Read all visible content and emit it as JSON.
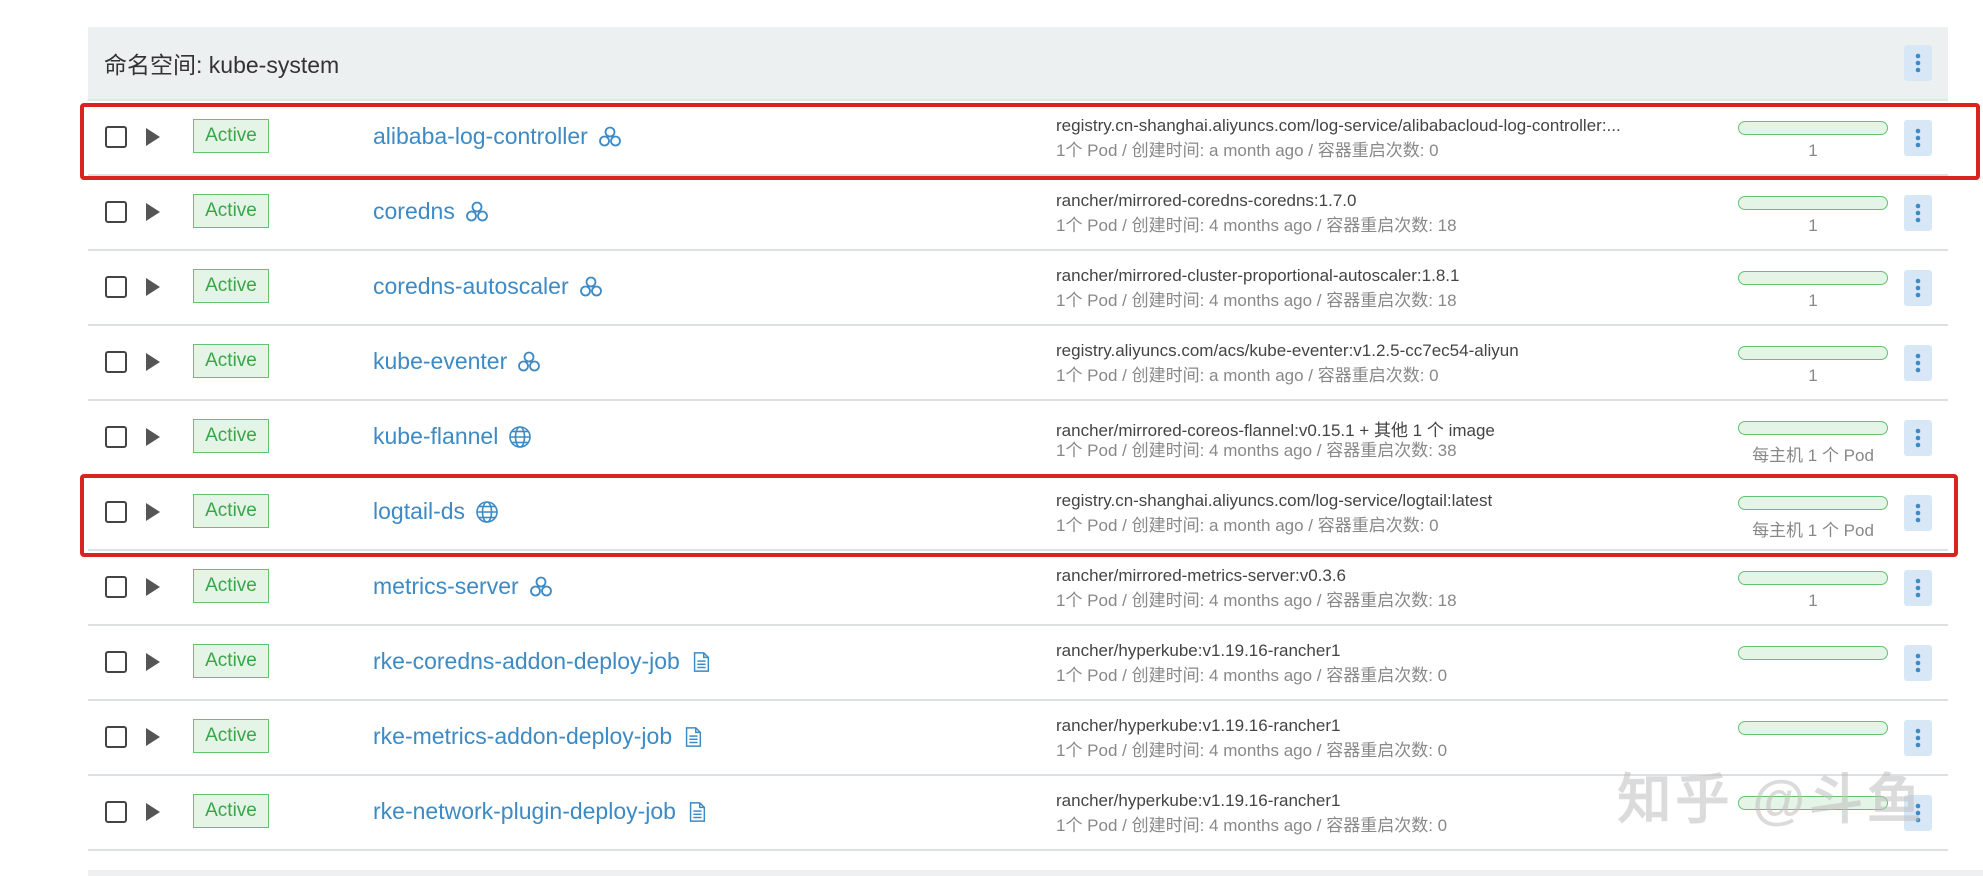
{
  "namespace": {
    "title": "命名空间: kube-system"
  },
  "rows": [
    {
      "state": "Active",
      "name": "alibaba-log-controller",
      "icon": "deployment-icon",
      "image": "registry.cn-shanghai.aliyuncs.com/log-service/alibabacloud-log-controller:...",
      "meta": "1个 Pod / 创建时间: a month ago / 容器重启次数: 0",
      "scale": "1",
      "scale_fill": 1.0
    },
    {
      "state": "Active",
      "name": "coredns",
      "icon": "deployment-icon",
      "image": "rancher/mirrored-coredns-coredns:1.7.0",
      "meta": "1个 Pod / 创建时间: 4 months ago / 容器重启次数: 18",
      "scale": "1",
      "scale_fill": 1.0
    },
    {
      "state": "Active",
      "name": "coredns-autoscaler",
      "icon": "deployment-icon",
      "image": "rancher/mirrored-cluster-proportional-autoscaler:1.8.1",
      "meta": "1个 Pod / 创建时间: 4 months ago / 容器重启次数: 18",
      "scale": "1",
      "scale_fill": 1.0
    },
    {
      "state": "Active",
      "name": "kube-eventer",
      "icon": "deployment-icon",
      "image": "registry.aliyuncs.com/acs/kube-eventer:v1.2.5-cc7ec54-aliyun",
      "meta": "1个 Pod / 创建时间: a month ago / 容器重启次数: 0",
      "scale": "1",
      "scale_fill": 1.0
    },
    {
      "state": "Active",
      "name": "kube-flannel",
      "icon": "globe-icon",
      "image": "rancher/mirrored-coreos-flannel:v0.15.1 + 其他 1 个 image",
      "meta": "1个 Pod / 创建时间: 4 months ago / 容器重启次数: 38",
      "scale": "每主机 1 个 Pod",
      "scale_fill": 1.0
    },
    {
      "state": "Active",
      "name": "logtail-ds",
      "icon": "globe-icon",
      "image": "registry.cn-shanghai.aliyuncs.com/log-service/logtail:latest",
      "meta": "1个 Pod / 创建时间: a month ago / 容器重启次数: 0",
      "scale": "每主机 1 个 Pod",
      "scale_fill": 1.0
    },
    {
      "state": "Active",
      "name": "metrics-server",
      "icon": "deployment-icon",
      "image": "rancher/mirrored-metrics-server:v0.3.6",
      "meta": "1个 Pod / 创建时间: 4 months ago / 容器重启次数: 18",
      "scale": "1",
      "scale_fill": 1.0
    },
    {
      "state": "Active",
      "name": "rke-coredns-addon-deploy-job",
      "icon": "document-icon",
      "image": "rancher/hyperkube:v1.19.16-rancher1",
      "meta": "1个 Pod / 创建时间: 4 months ago / 容器重启次数: 0",
      "scale": "",
      "scale_fill": 1.0
    },
    {
      "state": "Active",
      "name": "rke-metrics-addon-deploy-job",
      "icon": "document-icon",
      "image": "rancher/hyperkube:v1.19.16-rancher1",
      "meta": "1个 Pod / 创建时间: 4 months ago / 容器重启次数: 0",
      "scale": "",
      "scale_fill": 1.0
    },
    {
      "state": "Active",
      "name": "rke-network-plugin-deploy-job",
      "icon": "document-icon",
      "image": "rancher/hyperkube:v1.19.16-rancher1",
      "meta": "1个 Pod / 创建时间: 4 months ago / 容器重启次数: 0",
      "scale": "",
      "scale_fill": 1.0
    }
  ],
  "watermark": "知乎 @斗鱼",
  "colors": {
    "active": "#3aa64a",
    "link": "#3d8ac4",
    "highlight": "#d9231e"
  }
}
